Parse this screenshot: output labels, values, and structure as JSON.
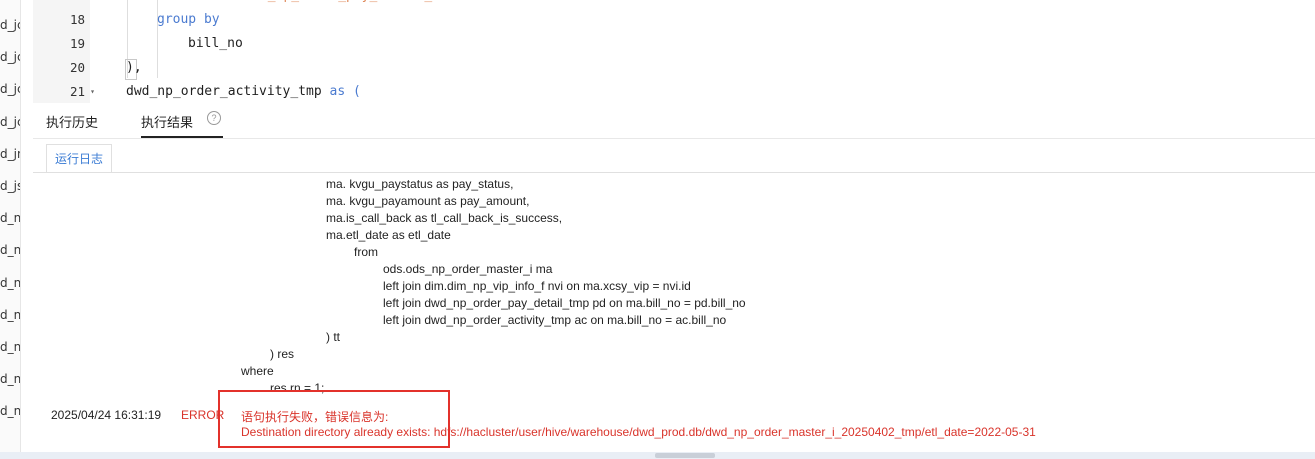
{
  "file_list": [
    "d_jc",
    "d_jc",
    "d_jc",
    "d_jc",
    "d_jn",
    "d_js",
    "d_n",
    "d_n",
    "d_n",
    "d_n",
    "d_n",
    "d_n",
    "d_n"
  ],
  "editor": {
    "lines": [
      {
        "number": "18",
        "code_kw": "group by",
        "code": ""
      },
      {
        "number": "19",
        "code_kw": "",
        "code": "bill_no"
      },
      {
        "number": "20",
        "code_kw": "",
        "code": "),"
      },
      {
        "number": "21",
        "code_kw": "",
        "code": "dwd_np_order_activity_tmp"
      }
    ],
    "line21_as": "as (",
    "line17_partial": "dwd.dwd_np_order_pay_detail_i",
    "fold_icon": "chevron-down-icon"
  },
  "tabs": {
    "history": "执行历史",
    "results": "执行结果",
    "help_icon": "?"
  },
  "log_tab": "运行日志",
  "log_lines": [
    "ma. kvgu_paystatus as pay_status,",
    "ma. kvgu_payamount as pay_amount,",
    "ma.is_call_back as tl_call_back_is_success,",
    "ma.etl_date as etl_date",
    "from",
    "ods.ods_np_order_master_i ma",
    "left join dim.dim_np_vip_info_f nvi on ma.xcsy_vip = nvi.id",
    "left join dwd_np_order_pay_detail_tmp pd on ma.bill_no = pd.bill_no",
    "left join dwd_np_order_activity_tmp ac on ma.bill_no = ac.bill_no",
    ") tt",
    ") res",
    "where",
    "res.rn = 1;"
  ],
  "error": {
    "timestamp": "2025/04/24 16:31:19",
    "level": "ERROR",
    "message_line1": "语句执行失败，错误信息为:",
    "message_line2": "Destination directory already exists: hdfs://hacluster/user/hive/warehouse/dwd_prod.db/dwd_np_order_master_i_20250402_tmp/etl_date=2022-05-31"
  },
  "colors": {
    "error_red": "#d9342b",
    "keyword_blue": "#4b7bd0",
    "tab_blue": "#3b7cd4"
  }
}
